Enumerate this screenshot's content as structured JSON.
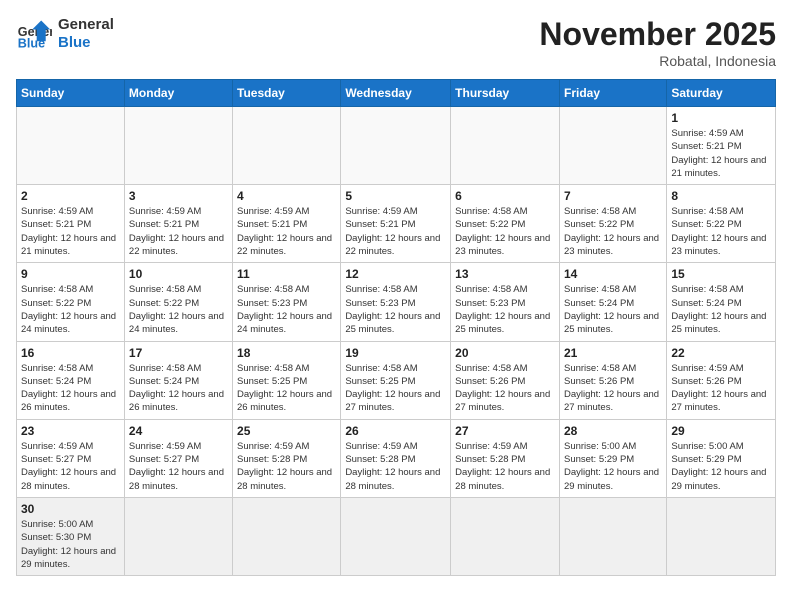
{
  "header": {
    "logo_line1": "General",
    "logo_line2": "Blue",
    "title": "November 2025",
    "subtitle": "Robatal, Indonesia"
  },
  "weekdays": [
    "Sunday",
    "Monday",
    "Tuesday",
    "Wednesday",
    "Thursday",
    "Friday",
    "Saturday"
  ],
  "weeks": [
    [
      {
        "day": "",
        "info": ""
      },
      {
        "day": "",
        "info": ""
      },
      {
        "day": "",
        "info": ""
      },
      {
        "day": "",
        "info": ""
      },
      {
        "day": "",
        "info": ""
      },
      {
        "day": "",
        "info": ""
      },
      {
        "day": "1",
        "info": "Sunrise: 4:59 AM\nSunset: 5:21 PM\nDaylight: 12 hours and 21 minutes."
      }
    ],
    [
      {
        "day": "2",
        "info": "Sunrise: 4:59 AM\nSunset: 5:21 PM\nDaylight: 12 hours and 21 minutes."
      },
      {
        "day": "3",
        "info": "Sunrise: 4:59 AM\nSunset: 5:21 PM\nDaylight: 12 hours and 22 minutes."
      },
      {
        "day": "4",
        "info": "Sunrise: 4:59 AM\nSunset: 5:21 PM\nDaylight: 12 hours and 22 minutes."
      },
      {
        "day": "5",
        "info": "Sunrise: 4:59 AM\nSunset: 5:21 PM\nDaylight: 12 hours and 22 minutes."
      },
      {
        "day": "6",
        "info": "Sunrise: 4:58 AM\nSunset: 5:22 PM\nDaylight: 12 hours and 23 minutes."
      },
      {
        "day": "7",
        "info": "Sunrise: 4:58 AM\nSunset: 5:22 PM\nDaylight: 12 hours and 23 minutes."
      },
      {
        "day": "8",
        "info": "Sunrise: 4:58 AM\nSunset: 5:22 PM\nDaylight: 12 hours and 23 minutes."
      }
    ],
    [
      {
        "day": "9",
        "info": "Sunrise: 4:58 AM\nSunset: 5:22 PM\nDaylight: 12 hours and 24 minutes."
      },
      {
        "day": "10",
        "info": "Sunrise: 4:58 AM\nSunset: 5:22 PM\nDaylight: 12 hours and 24 minutes."
      },
      {
        "day": "11",
        "info": "Sunrise: 4:58 AM\nSunset: 5:23 PM\nDaylight: 12 hours and 24 minutes."
      },
      {
        "day": "12",
        "info": "Sunrise: 4:58 AM\nSunset: 5:23 PM\nDaylight: 12 hours and 25 minutes."
      },
      {
        "day": "13",
        "info": "Sunrise: 4:58 AM\nSunset: 5:23 PM\nDaylight: 12 hours and 25 minutes."
      },
      {
        "day": "14",
        "info": "Sunrise: 4:58 AM\nSunset: 5:24 PM\nDaylight: 12 hours and 25 minutes."
      },
      {
        "day": "15",
        "info": "Sunrise: 4:58 AM\nSunset: 5:24 PM\nDaylight: 12 hours and 25 minutes."
      }
    ],
    [
      {
        "day": "16",
        "info": "Sunrise: 4:58 AM\nSunset: 5:24 PM\nDaylight: 12 hours and 26 minutes."
      },
      {
        "day": "17",
        "info": "Sunrise: 4:58 AM\nSunset: 5:24 PM\nDaylight: 12 hours and 26 minutes."
      },
      {
        "day": "18",
        "info": "Sunrise: 4:58 AM\nSunset: 5:25 PM\nDaylight: 12 hours and 26 minutes."
      },
      {
        "day": "19",
        "info": "Sunrise: 4:58 AM\nSunset: 5:25 PM\nDaylight: 12 hours and 27 minutes."
      },
      {
        "day": "20",
        "info": "Sunrise: 4:58 AM\nSunset: 5:26 PM\nDaylight: 12 hours and 27 minutes."
      },
      {
        "day": "21",
        "info": "Sunrise: 4:58 AM\nSunset: 5:26 PM\nDaylight: 12 hours and 27 minutes."
      },
      {
        "day": "22",
        "info": "Sunrise: 4:59 AM\nSunset: 5:26 PM\nDaylight: 12 hours and 27 minutes."
      }
    ],
    [
      {
        "day": "23",
        "info": "Sunrise: 4:59 AM\nSunset: 5:27 PM\nDaylight: 12 hours and 28 minutes."
      },
      {
        "day": "24",
        "info": "Sunrise: 4:59 AM\nSunset: 5:27 PM\nDaylight: 12 hours and 28 minutes."
      },
      {
        "day": "25",
        "info": "Sunrise: 4:59 AM\nSunset: 5:28 PM\nDaylight: 12 hours and 28 minutes."
      },
      {
        "day": "26",
        "info": "Sunrise: 4:59 AM\nSunset: 5:28 PM\nDaylight: 12 hours and 28 minutes."
      },
      {
        "day": "27",
        "info": "Sunrise: 4:59 AM\nSunset: 5:28 PM\nDaylight: 12 hours and 28 minutes."
      },
      {
        "day": "28",
        "info": "Sunrise: 5:00 AM\nSunset: 5:29 PM\nDaylight: 12 hours and 29 minutes."
      },
      {
        "day": "29",
        "info": "Sunrise: 5:00 AM\nSunset: 5:29 PM\nDaylight: 12 hours and 29 minutes."
      }
    ],
    [
      {
        "day": "30",
        "info": "Sunrise: 5:00 AM\nSunset: 5:30 PM\nDaylight: 12 hours and 29 minutes."
      },
      {
        "day": "",
        "info": ""
      },
      {
        "day": "",
        "info": ""
      },
      {
        "day": "",
        "info": ""
      },
      {
        "day": "",
        "info": ""
      },
      {
        "day": "",
        "info": ""
      },
      {
        "day": "",
        "info": ""
      }
    ]
  ]
}
